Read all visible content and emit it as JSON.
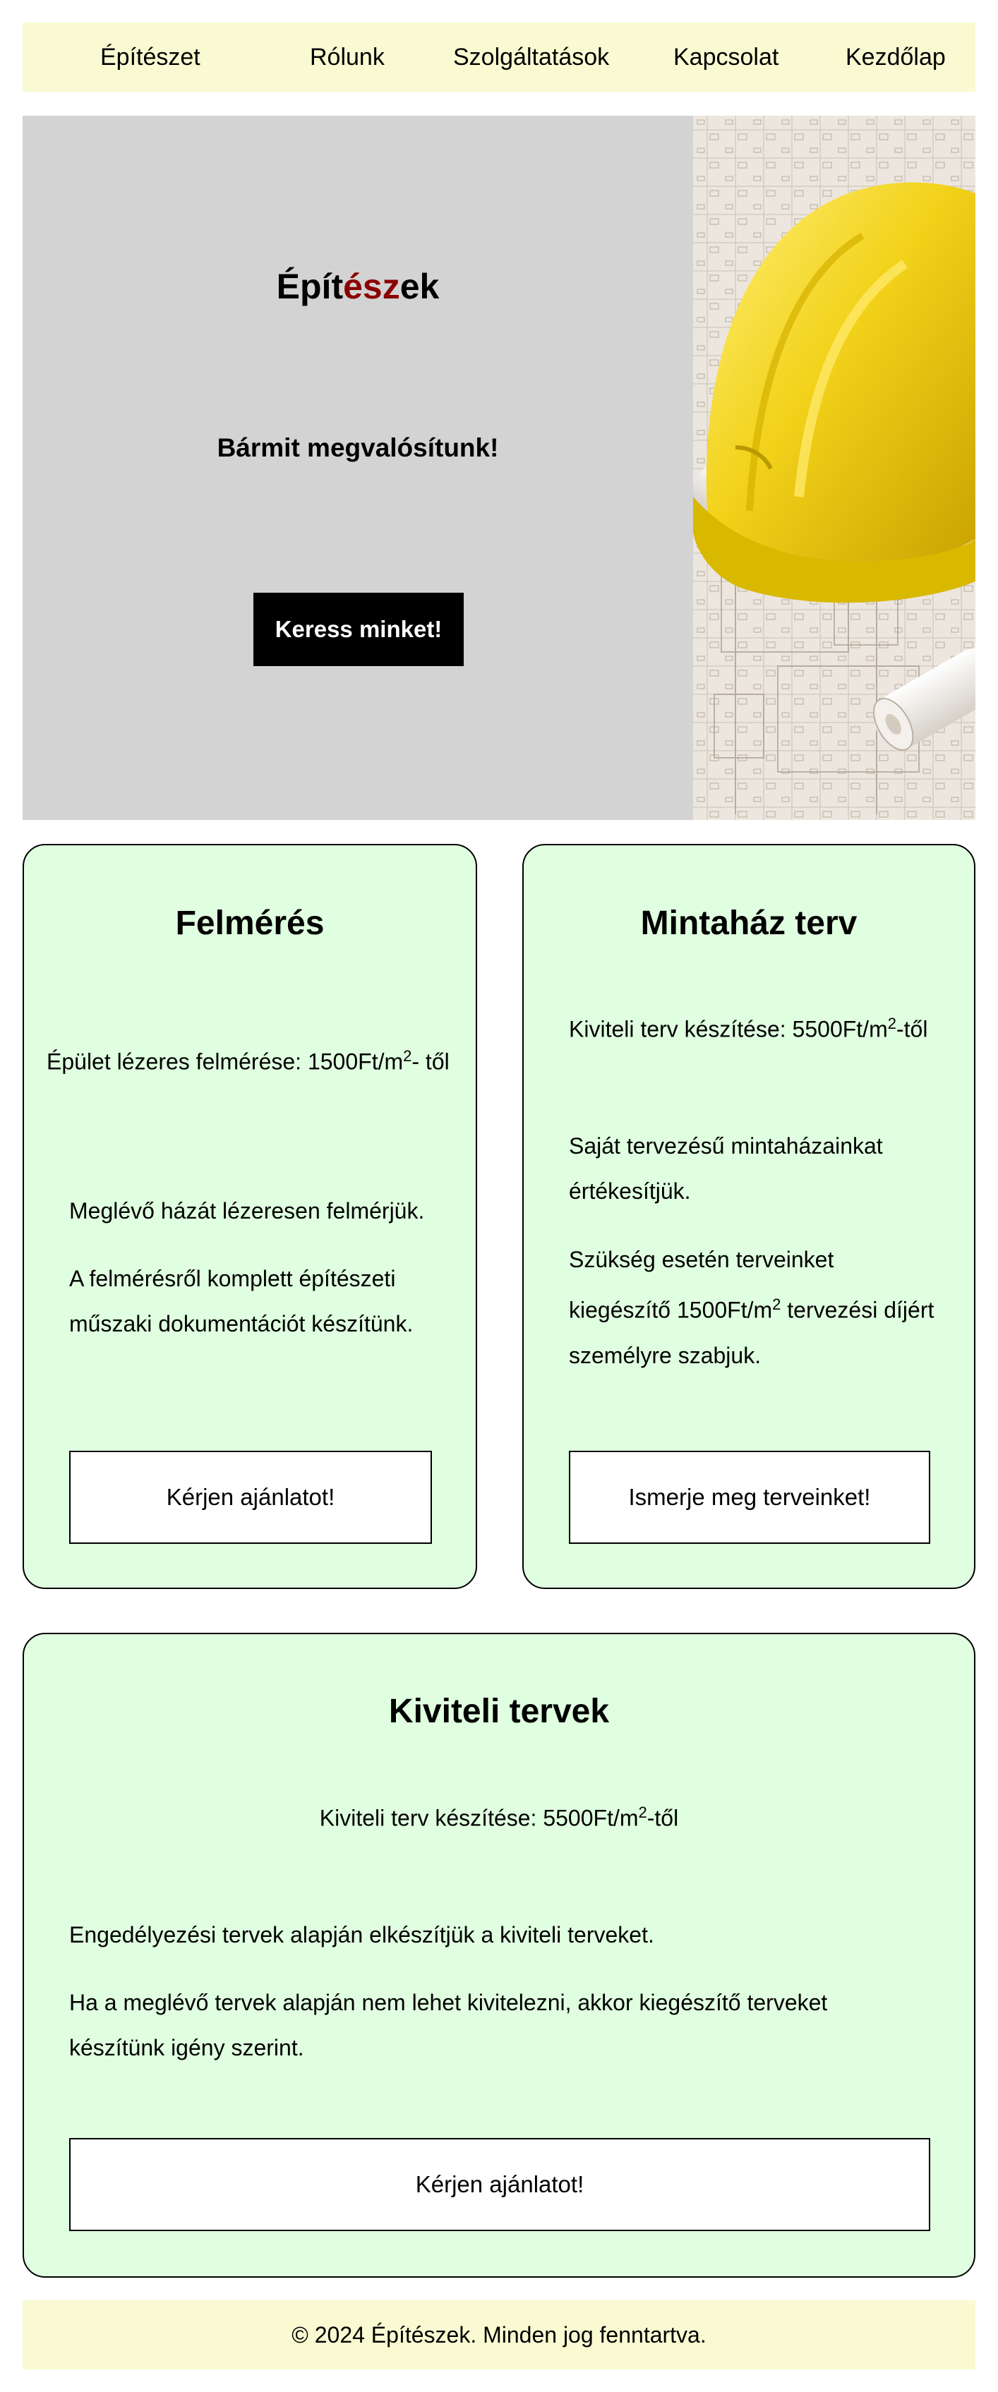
{
  "nav": {
    "items": [
      "Építészet",
      "Rólunk",
      "Szolgáltatások",
      "Kapcsolat",
      "Kezdőlap"
    ]
  },
  "hero": {
    "title_part1": "Épít",
    "title_accent": "ész",
    "title_part2": "ek",
    "subtitle": "Bármit megvalósítunk!",
    "button": "Keress minket!",
    "image_icon": "hard-hat-blueprints-image"
  },
  "cards": {
    "felmeres": {
      "title": "Felmérés",
      "price_prefix": "Épület lézeres felmérése: 1500Ft/m",
      "price_sup": "2",
      "price_suffix": "- től",
      "p1": "Meglévő házát lézeresen felmérjük.",
      "p2": "A felmérésről komplett építészeti műszaki dokumentációt készítünk.",
      "button": "Kérjen ajánlatot!"
    },
    "mintahaz": {
      "title": "Mintaház terv",
      "price_prefix": "Kiviteli terv készítése: 5500Ft/m",
      "price_sup": "2",
      "price_suffix": "-től",
      "p1": "Saját tervezésű mintaházainkat értékesítjük.",
      "p2_prefix": "Szükség esetén terveinket kiegészítő 1500Ft/m",
      "p2_sup": "2",
      "p2_suffix": " tervezési díjért személyre szabjuk.",
      "button": "Ismerje meg terveinket!"
    },
    "kiviteli": {
      "title": "Kiviteli tervek",
      "price_prefix": "Kiviteli terv készítése: 5500Ft/m",
      "price_sup": "2",
      "price_suffix": "-től",
      "p1": "Engedélyezési tervek alapján elkészítjük a kiviteli terveket.",
      "p2": "Ha a meglévő tervek alapján nem lehet kivitelezni, akkor kiegészítő terveket készítünk igény szerint.",
      "button": "Kérjen ajánlatot!"
    }
  },
  "footer": {
    "text": "© 2024 Építészek. Minden jog fenntartva."
  },
  "colors": {
    "nav_bg": "#fafad2",
    "hero_bg": "#d3d3d3",
    "accent": "#8b0000",
    "card_bg": "#e0ffe0",
    "button_dark": "#000000"
  }
}
